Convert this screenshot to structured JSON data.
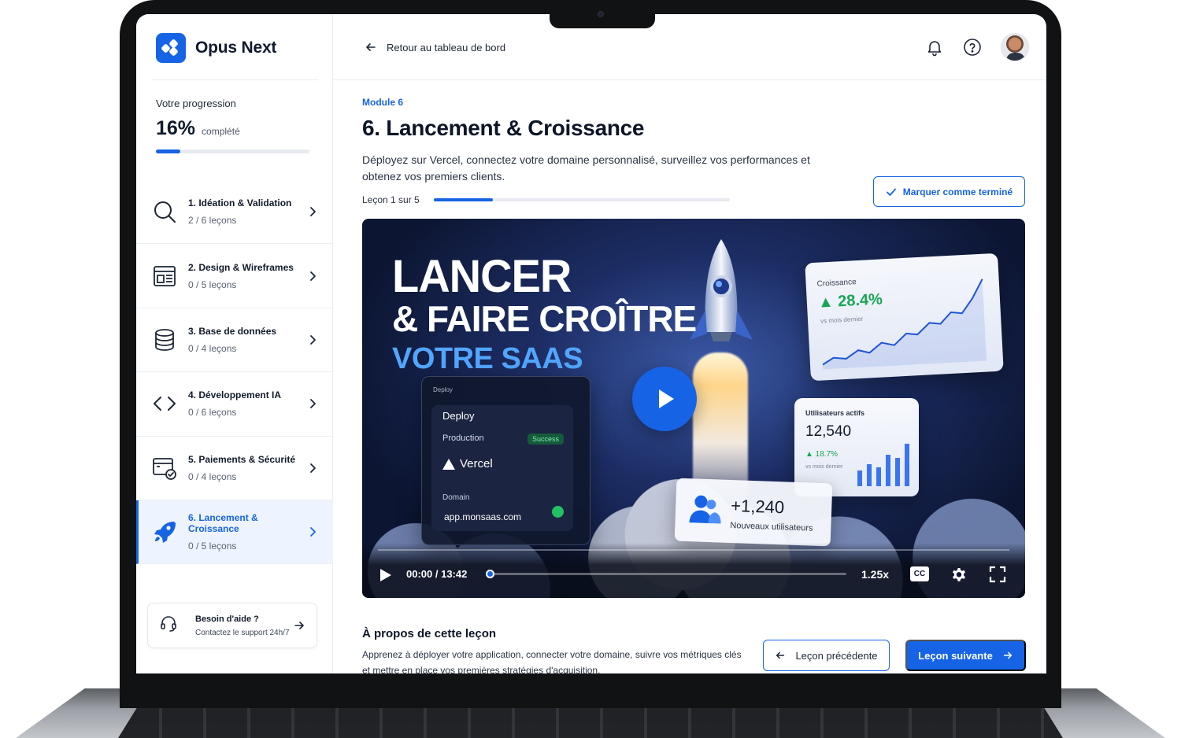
{
  "brand": {
    "name": "Opus Next",
    "accent": "#1664e5"
  },
  "progress": {
    "label": "Votre progression",
    "percent_text": "16%",
    "suffix": "complété",
    "value": 0.16
  },
  "modules": [
    {
      "title": "1. Idéation & Validation",
      "count": "2 / 6 leçons",
      "icon": "search-icon",
      "active": false
    },
    {
      "title": "2. Design & Wireframes",
      "count": "0 / 5 leçons",
      "icon": "layout-icon",
      "active": false
    },
    {
      "title": "3. Base de données",
      "count": "0 / 4 leçons",
      "icon": "database-icon",
      "active": false
    },
    {
      "title": "4. Développement IA",
      "count": "0 / 6 leçons",
      "icon": "code-icon",
      "active": false
    },
    {
      "title": "5. Paiements & Sécurité",
      "count": "0 / 4 leçons",
      "icon": "payment-secure-icon",
      "active": false
    },
    {
      "title": "6. Lancement & Croissance",
      "count": "0 / 5 leçons",
      "icon": "rocket-icon",
      "active": true
    }
  ],
  "help": {
    "title": "Besoin d'aide ?",
    "subtitle": "Contactez le support 24h/7"
  },
  "header": {
    "back_label": "Retour au tableau de bord"
  },
  "lesson": {
    "module_tag": "Module 6",
    "title": "6. Lancement & Croissance",
    "description": "Déployez sur Vercel, connectez votre domaine personnalisé, surveillez vos performances et obtenez vos premiers clients.",
    "progress_text": "Leçon 1 sur 5",
    "progress_value": 0.2,
    "mark_complete_label": "Marquer comme terminé"
  },
  "video": {
    "hero_line1": "LANCER",
    "hero_line2": "& FAIRE CROÎTRE",
    "hero_line3": "VOTRE SAAS",
    "deploy": {
      "header": "Deploy",
      "title": "Deploy",
      "env": "Production",
      "status": "Success",
      "provider": "Vercel",
      "domain_label": "Domain",
      "domain": "app.monsaas.com"
    },
    "growth": {
      "label": "Croissance",
      "value": "▲ 28.4%",
      "sub": "vs mois dernier"
    },
    "active_users": {
      "label": "Utilisateurs actifs",
      "value": "12,540",
      "change": "▲ 18.7%",
      "sub": "vs mois dernier"
    },
    "new_users": {
      "value": "+1,240",
      "label": "Nouveaux utilisateurs"
    },
    "time": "00:00 / 13:42",
    "speed": "1.25x",
    "cc": "CC"
  },
  "about": {
    "title": "À propos de cette leçon",
    "text": "Apprenez à déployer votre application, connecter votre domaine, suivre vos métriques clés et mettre en place vos premières stratégies d'acquisition."
  },
  "nav": {
    "prev_label": "Leçon précédente",
    "next_label": "Leçon suivante"
  }
}
